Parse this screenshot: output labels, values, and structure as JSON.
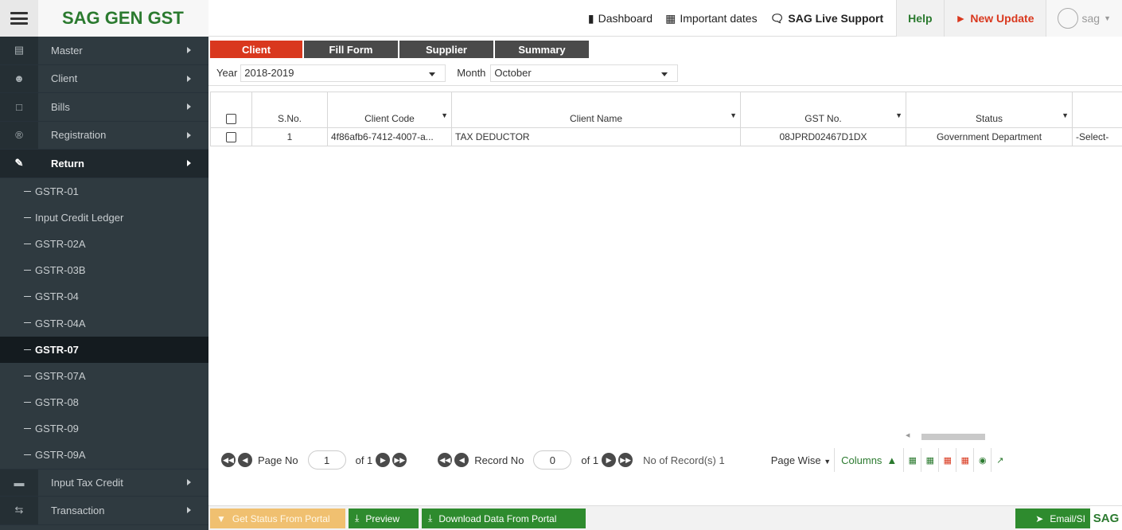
{
  "app": {
    "brand": "SAG GEN GST"
  },
  "topnav": {
    "dashboard": "Dashboard",
    "important_dates": "Important dates",
    "live_support": "SAG Live Support",
    "help": "Help",
    "new_update": "New Update",
    "user": "sag"
  },
  "sidebar": {
    "items": [
      {
        "label": "Master",
        "icon": "database-icon"
      },
      {
        "label": "Client",
        "icon": "users-icon"
      },
      {
        "label": "Bills",
        "icon": "bills-icon"
      },
      {
        "label": "Registration",
        "icon": "registered-icon"
      },
      {
        "label": "Return",
        "icon": "edit-icon"
      }
    ],
    "subitems": [
      "GSTR-01",
      "Input Credit Ledger",
      "GSTR-02A",
      "GSTR-03B",
      "GSTR-04",
      "GSTR-04A",
      "GSTR-07",
      "GSTR-07A",
      "GSTR-08",
      "GSTR-09",
      "GSTR-09A"
    ],
    "current_sub": "GSTR-07",
    "after": [
      {
        "label": "Input Tax Credit",
        "icon": "card-icon"
      },
      {
        "label": "Transaction",
        "icon": "exchange-icon"
      }
    ]
  },
  "tabs": [
    "Client",
    "Fill Form",
    "Supplier",
    "Summary"
  ],
  "filters": {
    "year_label": "Year",
    "year_value": "2018-2019",
    "month_label": "Month",
    "month_value": "October"
  },
  "grid": {
    "columns": [
      "S.No.",
      "Client Code",
      "Client Name",
      "GST No.",
      "Status",
      ""
    ],
    "rows": [
      {
        "sno": "1",
        "client_code": "4f86afb6-7412-4007-a...",
        "client_name": "TAX DEDUCTOR",
        "gst_no": "08JPRD02467D1DX",
        "status": "Government Department",
        "extra": "-Select-"
      }
    ]
  },
  "pager": {
    "page_label": "Page No",
    "page_value": "1",
    "page_of": "of 1",
    "record_label": "Record No",
    "record_value": "0",
    "record_of": "of 1",
    "records_count": "No of Record(s) 1",
    "page_wise": "Page Wise",
    "columns": "Columns"
  },
  "bottom": {
    "get_status": "Get Status From Portal",
    "preview": "Preview",
    "download": "Download Data From Portal",
    "email": "Email/SI",
    "logo": "SAG"
  },
  "colors": {
    "brand_green": "#2b7a2f",
    "tab_red": "#d9381e",
    "sidebar": "#2f3a40"
  }
}
